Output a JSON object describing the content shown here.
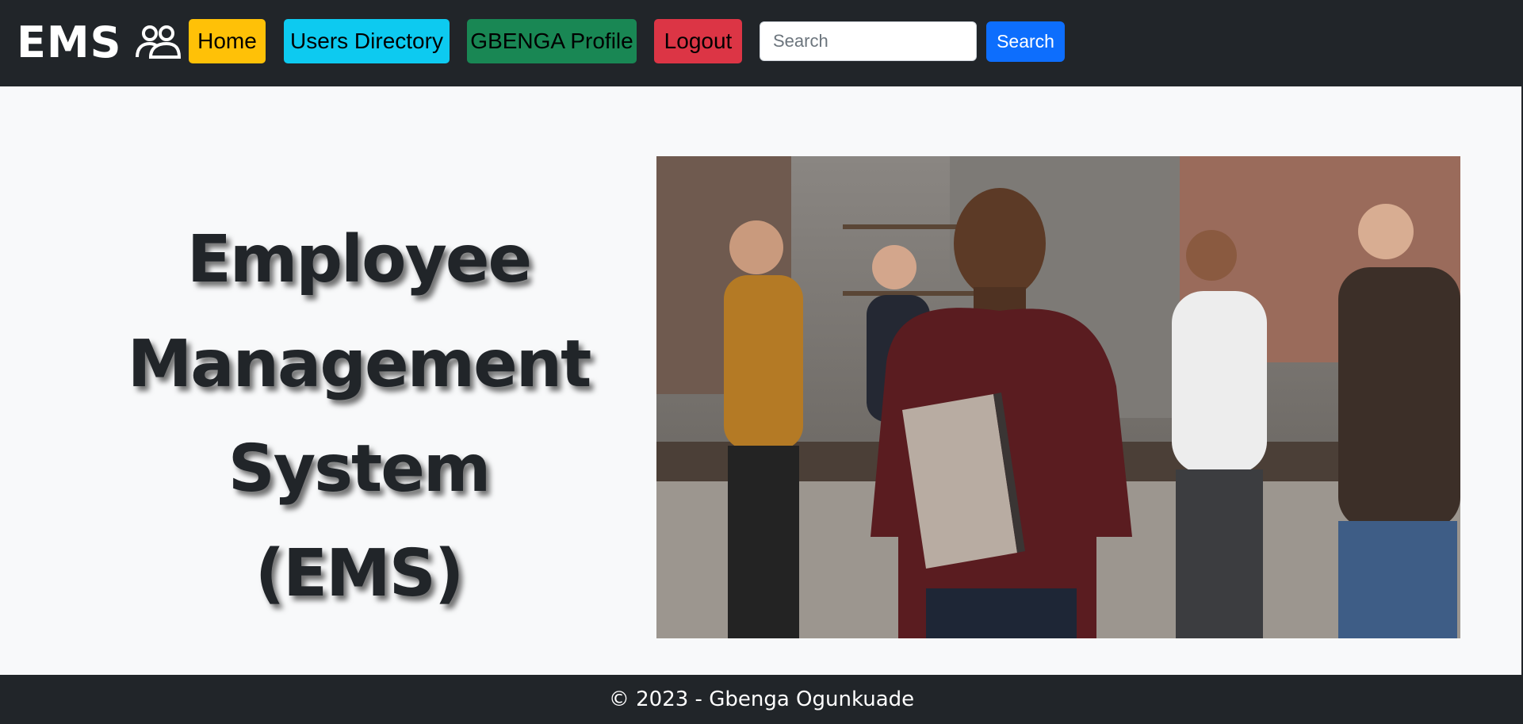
{
  "navbar": {
    "brand": "EMS",
    "brand_icon": "people-icon",
    "buttons": {
      "home": "Home",
      "users": "Users Directory",
      "profile": "GBENGA Profile",
      "logout": "Logout"
    },
    "search": {
      "placeholder": "Search",
      "value": "",
      "button_label": "Search"
    }
  },
  "hero": {
    "title_lines": [
      "Employee",
      "Management",
      "System",
      "(EMS)"
    ],
    "image": "office-team-photo"
  },
  "footer": {
    "text": "© 2023 - Gbenga Ogunkuade"
  },
  "colors": {
    "navbar_bg": "#212529",
    "home": "#ffc107",
    "users": "#0dcaf0",
    "profile": "#198754",
    "logout": "#dc3545",
    "search": "#0d6efd"
  }
}
